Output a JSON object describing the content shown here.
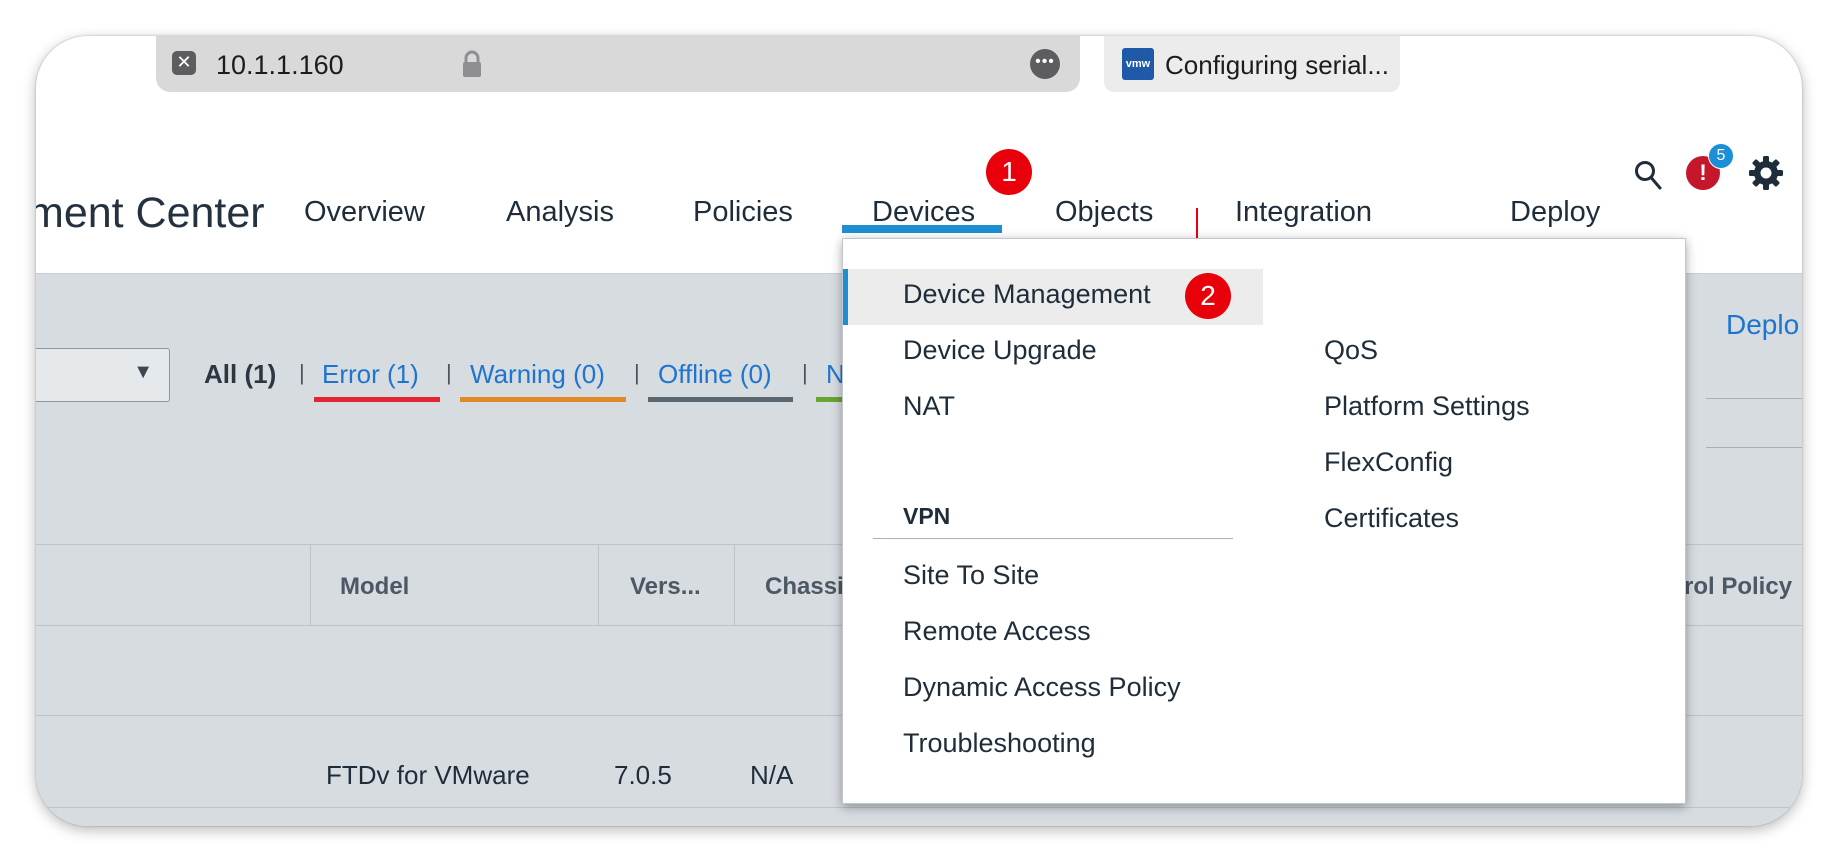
{
  "browser": {
    "url": "10.1.1.160",
    "more_label": "•••",
    "close_label": "✕",
    "second_tab": {
      "icon_text": "vmw",
      "title": "Configuring serial..."
    }
  },
  "header": {
    "brand": "ment Center",
    "nav": [
      "Overview",
      "Analysis",
      "Policies",
      "Devices",
      "Objects",
      "Integration"
    ],
    "active_nav": "Devices",
    "deploy": "Deploy",
    "alert_icon_text": "!",
    "alert_count": "5"
  },
  "annotations": {
    "step1": "1",
    "step2": "2"
  },
  "filters": {
    "all": "All (1)",
    "error": "Error (1)",
    "warning": "Warning (0)",
    "offline": "Offline (0)",
    "normal_partial": "N",
    "separator": "|"
  },
  "page_deploy_partial": "Deplo",
  "table": {
    "headers": {
      "model": "Model",
      "version": "Vers...",
      "chassis": "Chassi",
      "access_policy": "rol Policy"
    },
    "row": {
      "model": "FTDv for VMware",
      "version": "7.0.5",
      "chassis": "N/A"
    }
  },
  "dropdown": {
    "col1": [
      "Device Management",
      "Device Upgrade",
      "NAT"
    ],
    "vpn_heading": "VPN",
    "vpn_items": [
      "Site To Site",
      "Remote Access",
      "Dynamic Access Policy",
      "Troubleshooting"
    ],
    "col2": [
      "QoS",
      "Platform Settings",
      "FlexConfig",
      "Certificates"
    ],
    "active_item": "Device Management"
  },
  "colors": {
    "accent_blue": "#1d8ed2",
    "link_blue": "#1d75d1",
    "annotation_red": "#e8000a",
    "error_red": "#e32431",
    "warning_orange": "#e0892a",
    "offline_gray": "#5b6770",
    "normal_green": "#6aa431"
  },
  "icons": [
    "close-icon",
    "lock-icon",
    "more-icon",
    "vmware-icon",
    "search-icon",
    "alert-icon",
    "gear-icon",
    "dropdown-arrow-icon"
  ]
}
